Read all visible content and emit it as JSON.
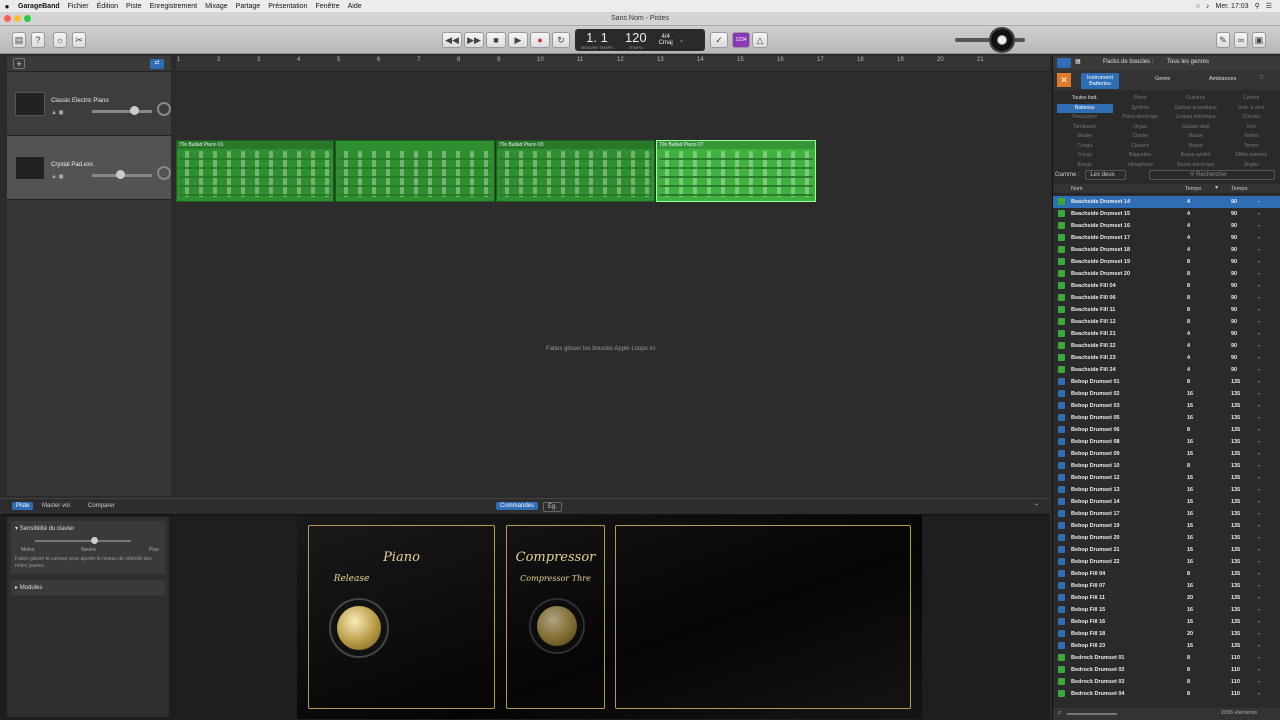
{
  "menubar": {
    "app": "GarageBand",
    "items": [
      "Fichier",
      "Édition",
      "Piste",
      "Enregistrement",
      "Mixage",
      "Partage",
      "Présentation",
      "Fenêtre",
      "Aide"
    ],
    "clock": "Mer. 17:03"
  },
  "window": {
    "title": "Sans Nom - Pistes"
  },
  "lcd": {
    "measure": "1. 1",
    "measure_lbl": "MESURE",
    "beat_lbl": "TEMPS",
    "tempo": "120",
    "tempo_lbl": "TEMPO",
    "sig": "4/4",
    "key": "Cmaj",
    "count_in": "1234"
  },
  "ruler": [
    "1",
    "2",
    "3",
    "4",
    "5",
    "6",
    "7",
    "8",
    "9",
    "10",
    "11",
    "12",
    "13",
    "14",
    "15",
    "16",
    "17",
    "18",
    "19",
    "20",
    "21"
  ],
  "tracks": [
    {
      "name": "Classic Electric Piano"
    },
    {
      "name": "Crystal Pad.exs"
    }
  ],
  "regions": [
    "70s Ballad Piano 01",
    "70s Ballad Piano 03",
    "70s Ballad Piano 07"
  ],
  "drop_hint": "Faites glisser les boucles Apple Loops ici.",
  "bottom": {
    "tabs": [
      "Piste",
      "Master vol.",
      "Comparer"
    ],
    "center_tabs": [
      "Commandes",
      "Ég."
    ],
    "sens": "Sensibilité du clavier",
    "less": "Moins",
    "neutral": "Neutre",
    "more": "Plus",
    "sens_desc": "Faites glisser le curseur pour ajuster le niveau de vélocité des notes jouées.",
    "modules": "Modules"
  },
  "plugins": {
    "piano": "Piano",
    "release": "Release",
    "comp": "Compressor",
    "comp_sub": "Compressor Thre"
  },
  "browser": {
    "packs_lbl": "Packs de boucles :",
    "packs_val": "Tous les genres",
    "tabs": [
      "Instrument",
      "Batteries",
      "Genre",
      "Ambiances"
    ],
    "grid": [
      "Toutes batt.",
      "Piano",
      "Guitares",
      "Cordes",
      "Batteries",
      "Synthés",
      "Guitare acoustique",
      "Instr. à vent",
      "Percussion",
      "Piano électrique",
      "Guitare électrique",
      "Cuivres",
      "Tambourin",
      "Orgue",
      "Guitare slide",
      "Voix",
      "Shaker",
      "Clavier",
      "Basse",
      "Textes",
      "Conga",
      "Claviers",
      "Basse",
      "Tempo",
      "Congs",
      "Baguettes",
      "Basse synthé",
      "Effets sonores",
      "Bongo",
      "Vibraphone",
      "Basse électrique",
      "Jingles"
    ],
    "gamme": "Gamme :",
    "gamme_val": "Les deux",
    "search": "Rechercher",
    "cols": {
      "name": "Nom",
      "beats": "Temps",
      "tempo": "Tempo"
    },
    "footer": "2095 éléments",
    "loops": [
      {
        "n": "Beachside Drumset 14",
        "b": "4",
        "t": "90",
        "k": "g"
      },
      {
        "n": "Beachside Drumset 15",
        "b": "4",
        "t": "90",
        "k": "g"
      },
      {
        "n": "Beachside Drumset 16",
        "b": "4",
        "t": "90",
        "k": "g"
      },
      {
        "n": "Beachside Drumset 17",
        "b": "4",
        "t": "90",
        "k": "g"
      },
      {
        "n": "Beachside Drumset 18",
        "b": "4",
        "t": "90",
        "k": "g"
      },
      {
        "n": "Beachside Drumset 19",
        "b": "8",
        "t": "90",
        "k": "g"
      },
      {
        "n": "Beachside Drumset 20",
        "b": "8",
        "t": "90",
        "k": "g"
      },
      {
        "n": "Beachside Fill 04",
        "b": "8",
        "t": "90",
        "k": "g"
      },
      {
        "n": "Beachside Fill 06",
        "b": "8",
        "t": "90",
        "k": "g"
      },
      {
        "n": "Beachside Fill 11",
        "b": "8",
        "t": "90",
        "k": "g"
      },
      {
        "n": "Beachside Fill 12",
        "b": "8",
        "t": "90",
        "k": "g"
      },
      {
        "n": "Beachside Fill 21",
        "b": "4",
        "t": "90",
        "k": "g"
      },
      {
        "n": "Beachside Fill 22",
        "b": "4",
        "t": "90",
        "k": "g"
      },
      {
        "n": "Beachside Fill 23",
        "b": "4",
        "t": "90",
        "k": "g"
      },
      {
        "n": "Beachside Fill 24",
        "b": "4",
        "t": "90",
        "k": "g"
      },
      {
        "n": "Bebop Drumset 01",
        "b": "8",
        "t": "135",
        "k": "b"
      },
      {
        "n": "Bebop Drumset 02",
        "b": "16",
        "t": "135",
        "k": "b"
      },
      {
        "n": "Bebop Drumset 03",
        "b": "16",
        "t": "135",
        "k": "b"
      },
      {
        "n": "Bebop Drumset 05",
        "b": "16",
        "t": "135",
        "k": "b"
      },
      {
        "n": "Bebop Drumset 06",
        "b": "8",
        "t": "135",
        "k": "b"
      },
      {
        "n": "Bebop Drumset 08",
        "b": "16",
        "t": "135",
        "k": "b"
      },
      {
        "n": "Bebop Drumset 09",
        "b": "16",
        "t": "135",
        "k": "b"
      },
      {
        "n": "Bebop Drumset 10",
        "b": "8",
        "t": "135",
        "k": "b"
      },
      {
        "n": "Bebop Drumset 12",
        "b": "16",
        "t": "135",
        "k": "b"
      },
      {
        "n": "Bebop Drumset 13",
        "b": "16",
        "t": "135",
        "k": "b"
      },
      {
        "n": "Bebop Drumset 14",
        "b": "16",
        "t": "135",
        "k": "b"
      },
      {
        "n": "Bebop Drumset 17",
        "b": "16",
        "t": "135",
        "k": "b"
      },
      {
        "n": "Bebop Drumset 19",
        "b": "16",
        "t": "135",
        "k": "b"
      },
      {
        "n": "Bebop Drumset 20",
        "b": "16",
        "t": "135",
        "k": "b"
      },
      {
        "n": "Bebop Drumset 21",
        "b": "16",
        "t": "135",
        "k": "b"
      },
      {
        "n": "Bebop Drumset 22",
        "b": "16",
        "t": "135",
        "k": "b"
      },
      {
        "n": "Bebop Fill 04",
        "b": "8",
        "t": "135",
        "k": "b"
      },
      {
        "n": "Bebop Fill 07",
        "b": "16",
        "t": "135",
        "k": "b"
      },
      {
        "n": "Bebop Fill 11",
        "b": "20",
        "t": "135",
        "k": "b"
      },
      {
        "n": "Bebop Fill 15",
        "b": "16",
        "t": "135",
        "k": "b"
      },
      {
        "n": "Bebop Fill 16",
        "b": "16",
        "t": "135",
        "k": "b"
      },
      {
        "n": "Bebop Fill 18",
        "b": "20",
        "t": "135",
        "k": "b"
      },
      {
        "n": "Bebop Fill 23",
        "b": "16",
        "t": "135",
        "k": "b"
      },
      {
        "n": "Bedrock Drumset 01",
        "b": "8",
        "t": "110",
        "k": "g"
      },
      {
        "n": "Bedrock Drumset 02",
        "b": "8",
        "t": "110",
        "k": "g"
      },
      {
        "n": "Bedrock Drumset 03",
        "b": "8",
        "t": "110",
        "k": "g"
      },
      {
        "n": "Bedrock Drumset 04",
        "b": "8",
        "t": "110",
        "k": "g"
      }
    ]
  },
  "colors": {
    "region": "#2e8f2e",
    "select": "#2f6db5",
    "record": "#d23030"
  }
}
